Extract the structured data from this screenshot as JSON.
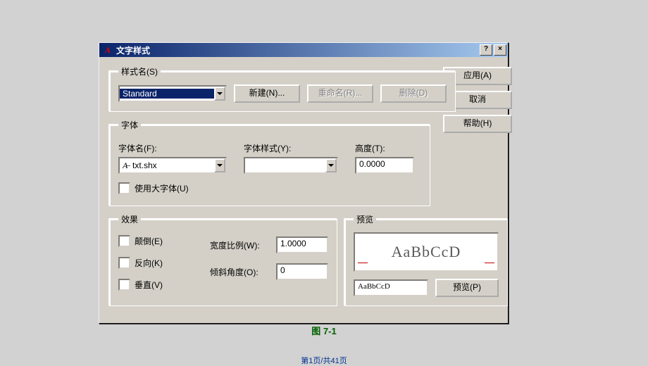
{
  "titlebar": {
    "icon": "A",
    "title": "文字样式",
    "help": "?",
    "close": "×"
  },
  "buttons": {
    "apply": "应用(A)",
    "cancel": "取消",
    "help": "帮助(H)",
    "new": "新建(N)...",
    "rename": "重命名(R)...",
    "delete": "删除(D)",
    "preview": "预览(P)"
  },
  "styleName": {
    "legend": "样式名(S)",
    "value": "Standard"
  },
  "font": {
    "legend": "字体",
    "nameLabel": "字体名(F):",
    "nameValue": "txt.shx",
    "styleLabel": "字体样式(Y):",
    "styleValue": "",
    "heightLabel": "高度(T):",
    "heightValue": "0.0000",
    "bigfontLabel": "使用大字体(U)"
  },
  "effects": {
    "legend": "效果",
    "upside": "颠倒(E)",
    "backward": "反向(K)",
    "vertical": "垂直(V)",
    "widthLabel": "宽度比例(W):",
    "widthValue": "1.0000",
    "obliqueLabel": "倾斜角度(O):",
    "obliqueValue": "0"
  },
  "preview": {
    "legend": "预览",
    "sample": "AaBbCcD",
    "inputValue": "AaBbCcD"
  },
  "caption": "图 7-1",
  "pager": "第1页/共41页"
}
